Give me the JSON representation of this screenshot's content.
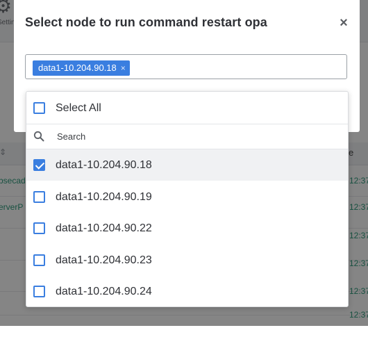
{
  "background": {
    "settings_text": "Settin",
    "table_rows": [
      {
        "name": "bsecad",
        "time": "12:37"
      },
      {
        "name": "erverP",
        "time": "12:37"
      },
      {
        "name": "",
        "time": "12:37"
      },
      {
        "name": "",
        "time": "12:37"
      },
      {
        "name": "",
        "time": "12:37"
      },
      {
        "name": "",
        "time": "12:37"
      }
    ],
    "col_right_header": "e"
  },
  "modal": {
    "title": "Select node to run command restart opa",
    "close_label": "×",
    "selected_tags": [
      {
        "label": "data1-10.204.90.18",
        "remove_label": "×"
      }
    ]
  },
  "dropdown": {
    "select_all_label": "Select All",
    "select_all_checked": false,
    "search_placeholder": "Search",
    "options": [
      {
        "label": "data1-10.204.90.18",
        "checked": true
      },
      {
        "label": "data1-10.204.90.19",
        "checked": false
      },
      {
        "label": "data1-10.204.90.22",
        "checked": false
      },
      {
        "label": "data1-10.204.90.23",
        "checked": false
      },
      {
        "label": "data1-10.204.90.24",
        "checked": false
      }
    ]
  },
  "icons": {
    "background_gear": "gear-icon",
    "search": "search-icon",
    "close": "close-icon"
  },
  "colors": {
    "accent": "#3a7ee0",
    "overlay": "rgba(0,0,0,0.48)",
    "link": "#2f9c7d"
  }
}
